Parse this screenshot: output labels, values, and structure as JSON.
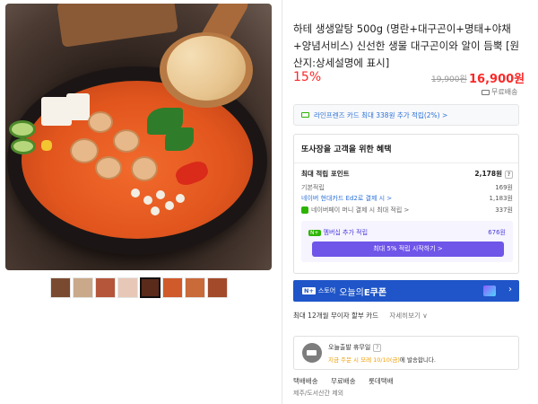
{
  "product": {
    "title": "하테 생생알탕 500g (명란+대구곤이+명태+야채+양념서비스) 신선한 생물 대구곤이와 알이 듬뿍 [원산지:상세설명에 표시]",
    "discount_rate": "15%",
    "original_price": "19,900원",
    "sale_price": "16,900원",
    "shipping": "무료배송",
    "thumbnails_count": 8,
    "active_thumbnail_index": 4
  },
  "card_promo": "라인프렌즈 카드 최대 338원 추가 적립(2%) >",
  "benefits": {
    "heading": "또사장을 고객을 위한 혜택",
    "max_points_label": "최대 적립 포인트",
    "max_points_value": "2,178원",
    "basic_label": "기본적립",
    "basic_value": "169원",
    "hyundai_label": "네이버 현대카드 Ed2로 결제 시 >",
    "hyundai_value": "1,183원",
    "npay_label": "네이버페이 머니 결제 시 최대 적립 >",
    "npay_value": "337원",
    "membership_badge": "N+",
    "membership_label": "멤버십 추가 적립",
    "membership_value": "676원",
    "membership_button": "최대 5% 적립 시작하기 >"
  },
  "ecoupon": {
    "badge": "N+",
    "store": "스토어",
    "label_prefix": "오늘의",
    "label_bold": "E쿠폰",
    "chevron": "›"
  },
  "installment": {
    "label": "최대 12개월 무이자 할부 카드",
    "more": "자세히보기 ∨"
  },
  "departure": {
    "line1": "오늘출발 휴무일",
    "line2_highlight": "지금 주문 시 모레 10/10(금)",
    "line2_rest": "에 발송합니다."
  },
  "shipping_info": {
    "type": "택배배송",
    "fee": "무료배송",
    "courier": "롯데택배",
    "note": "제주/도서산간 제외"
  }
}
